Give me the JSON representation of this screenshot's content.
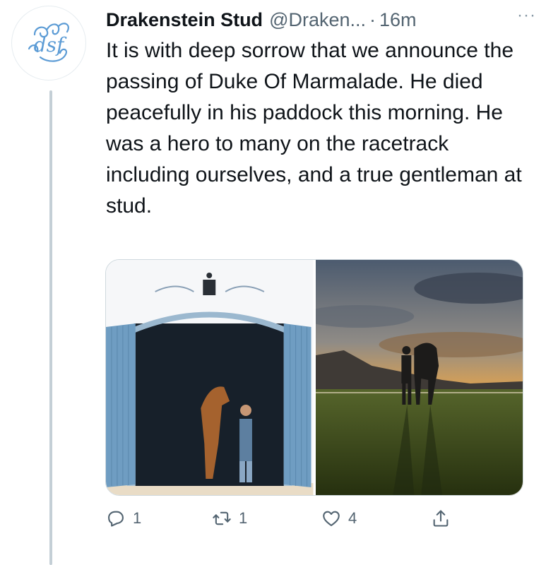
{
  "tweet": {
    "display_name": "Drakenstein Stud",
    "handle": "@Draken...",
    "separator": "·",
    "timestamp": "16m",
    "more_label": "···",
    "avatar_text": "dsf",
    "text": "It is with deep sorrow that we announce the passing of Duke Of Marmalade. He died peacefully in his paddock this morning. He was a hero to many on the racetrack including ourselves, and a true gentleman at stud.",
    "media": [
      {
        "name": "photo-horse-at-stable-door"
      },
      {
        "name": "photo-horse-at-sunset"
      }
    ],
    "actions": {
      "reply_count": "1",
      "retweet_count": "1",
      "like_count": "4"
    }
  },
  "colors": {
    "text_primary": "#0f1419",
    "text_secondary": "#536471",
    "logo_blue": "#5b9bd5",
    "thread_line": "#c4cfd6"
  }
}
